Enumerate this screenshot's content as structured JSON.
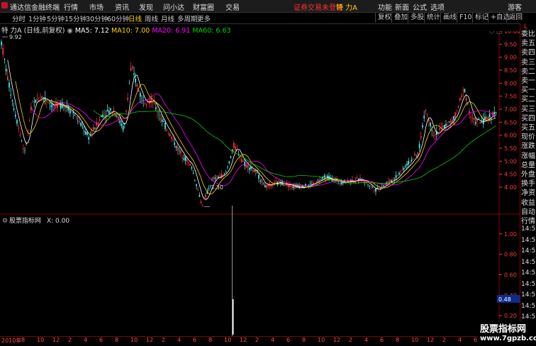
{
  "topbar": {
    "title": "通达信金融终端",
    "nav": [
      "行情",
      "市场",
      "资讯",
      "发现",
      "问小达",
      "财富圈",
      "交易"
    ],
    "warning": "证券交易未登录",
    "stock_name": "特 力A",
    "right_nav": [
      "功能",
      "新面",
      "公式",
      "选项",
      "游客"
    ]
  },
  "toolbar": {
    "timeframes": [
      "分时",
      "1分钟",
      "5分钟",
      "15分钟",
      "30分钟",
      "60分钟",
      "日线",
      "周线",
      "月线",
      "多周期",
      "更多"
    ],
    "active": "日线",
    "buttons": [
      "复权",
      "叠加",
      "多股",
      "统计",
      "画线",
      "F10",
      "标记",
      "+自选",
      "返回"
    ]
  },
  "title_line": {
    "name": "特 力A",
    "period": "(日线,前复权)",
    "ma5": "MA5: 7.12",
    "ma10": "MA10: 7.00",
    "ma20": "MA20: 6.91",
    "ma60": "MA60: 6.63"
  },
  "colors": {
    "up": "#ff3c3c",
    "down": "#54ffff",
    "ma5": "#ffffff",
    "ma10": "#ffd400",
    "ma20": "#ff00ff",
    "ma60": "#00d000",
    "axis": "#ff3c3c"
  },
  "main_chart": {
    "y_ticks": [
      "10.00",
      "9.50",
      "9.00",
      "8.50",
      "8.00",
      "7.50",
      "7.00",
      "6.50",
      "6.00",
      "5.50",
      "5.00",
      "4.50",
      "4.00"
    ],
    "high_label": "9.92",
    "low_label": "3.30"
  },
  "sub_chart": {
    "title": "股票指标网",
    "value": "X: 0.00",
    "y_ticks": [
      "1.00",
      "0.80",
      "0.60",
      "0.40",
      "0.20"
    ],
    "current_value": "0.48"
  },
  "right_panel": {
    "top_label": "L",
    "items": [
      "委比",
      "卖五",
      "卖四",
      "卖三",
      "卖二",
      "卖一",
      "买一",
      "买二",
      "买三",
      "买四",
      "买五",
      "现价",
      "涨跌",
      "涨幅",
      "总量",
      "外盘",
      "换手",
      "净资",
      "收益",
      "自动",
      "行情"
    ],
    "times": [
      "14:5",
      "14:5",
      "14:5",
      "14:5",
      "14:5",
      "14:5",
      "14:5",
      "14:5",
      "14:5"
    ]
  },
  "bottom_axis": {
    "ticks": [
      "2010年",
      "8",
      "10",
      "12",
      "2",
      "4",
      "6",
      "8",
      "10",
      "12",
      "2",
      "4",
      "6",
      "8",
      "10",
      "12",
      "2",
      "4",
      "6",
      "8",
      "10",
      "12",
      "2",
      "4",
      "6",
      "8",
      "10",
      "12",
      "2",
      "4",
      "6",
      "8"
    ]
  },
  "watermark": {
    "line1": "股票指标网",
    "line2": "www.7gpzb.com"
  }
}
